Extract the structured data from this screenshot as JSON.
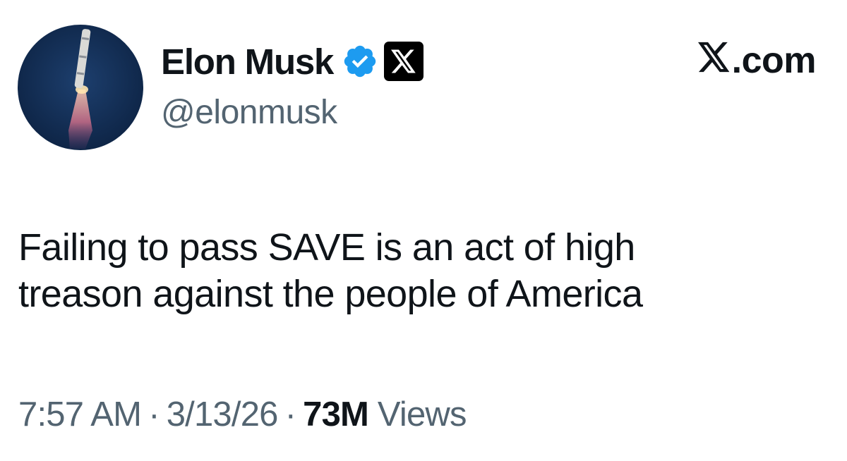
{
  "author": {
    "display_name": "Elon Musk",
    "handle": "@elonmusk",
    "avatar_icon": "rocket-launch-avatar",
    "verified_icon": "verified-badge-icon",
    "affiliation_icon": "x-logo-badge-icon"
  },
  "brand": {
    "text": ".com",
    "icon": "x-logo-icon"
  },
  "tweet": {
    "lines": [
      "Failing to pass SAVE is an act of high",
      "treason against the people of America"
    ]
  },
  "meta": {
    "time": "7:57 AM",
    "separator": "·",
    "date": "3/13/26",
    "views_count": "73M",
    "views_label": "Views"
  },
  "colors": {
    "primary_text": "#0f1419",
    "secondary_text": "#536471",
    "verified_blue": "#1d9bf0",
    "background": "#ffffff"
  }
}
